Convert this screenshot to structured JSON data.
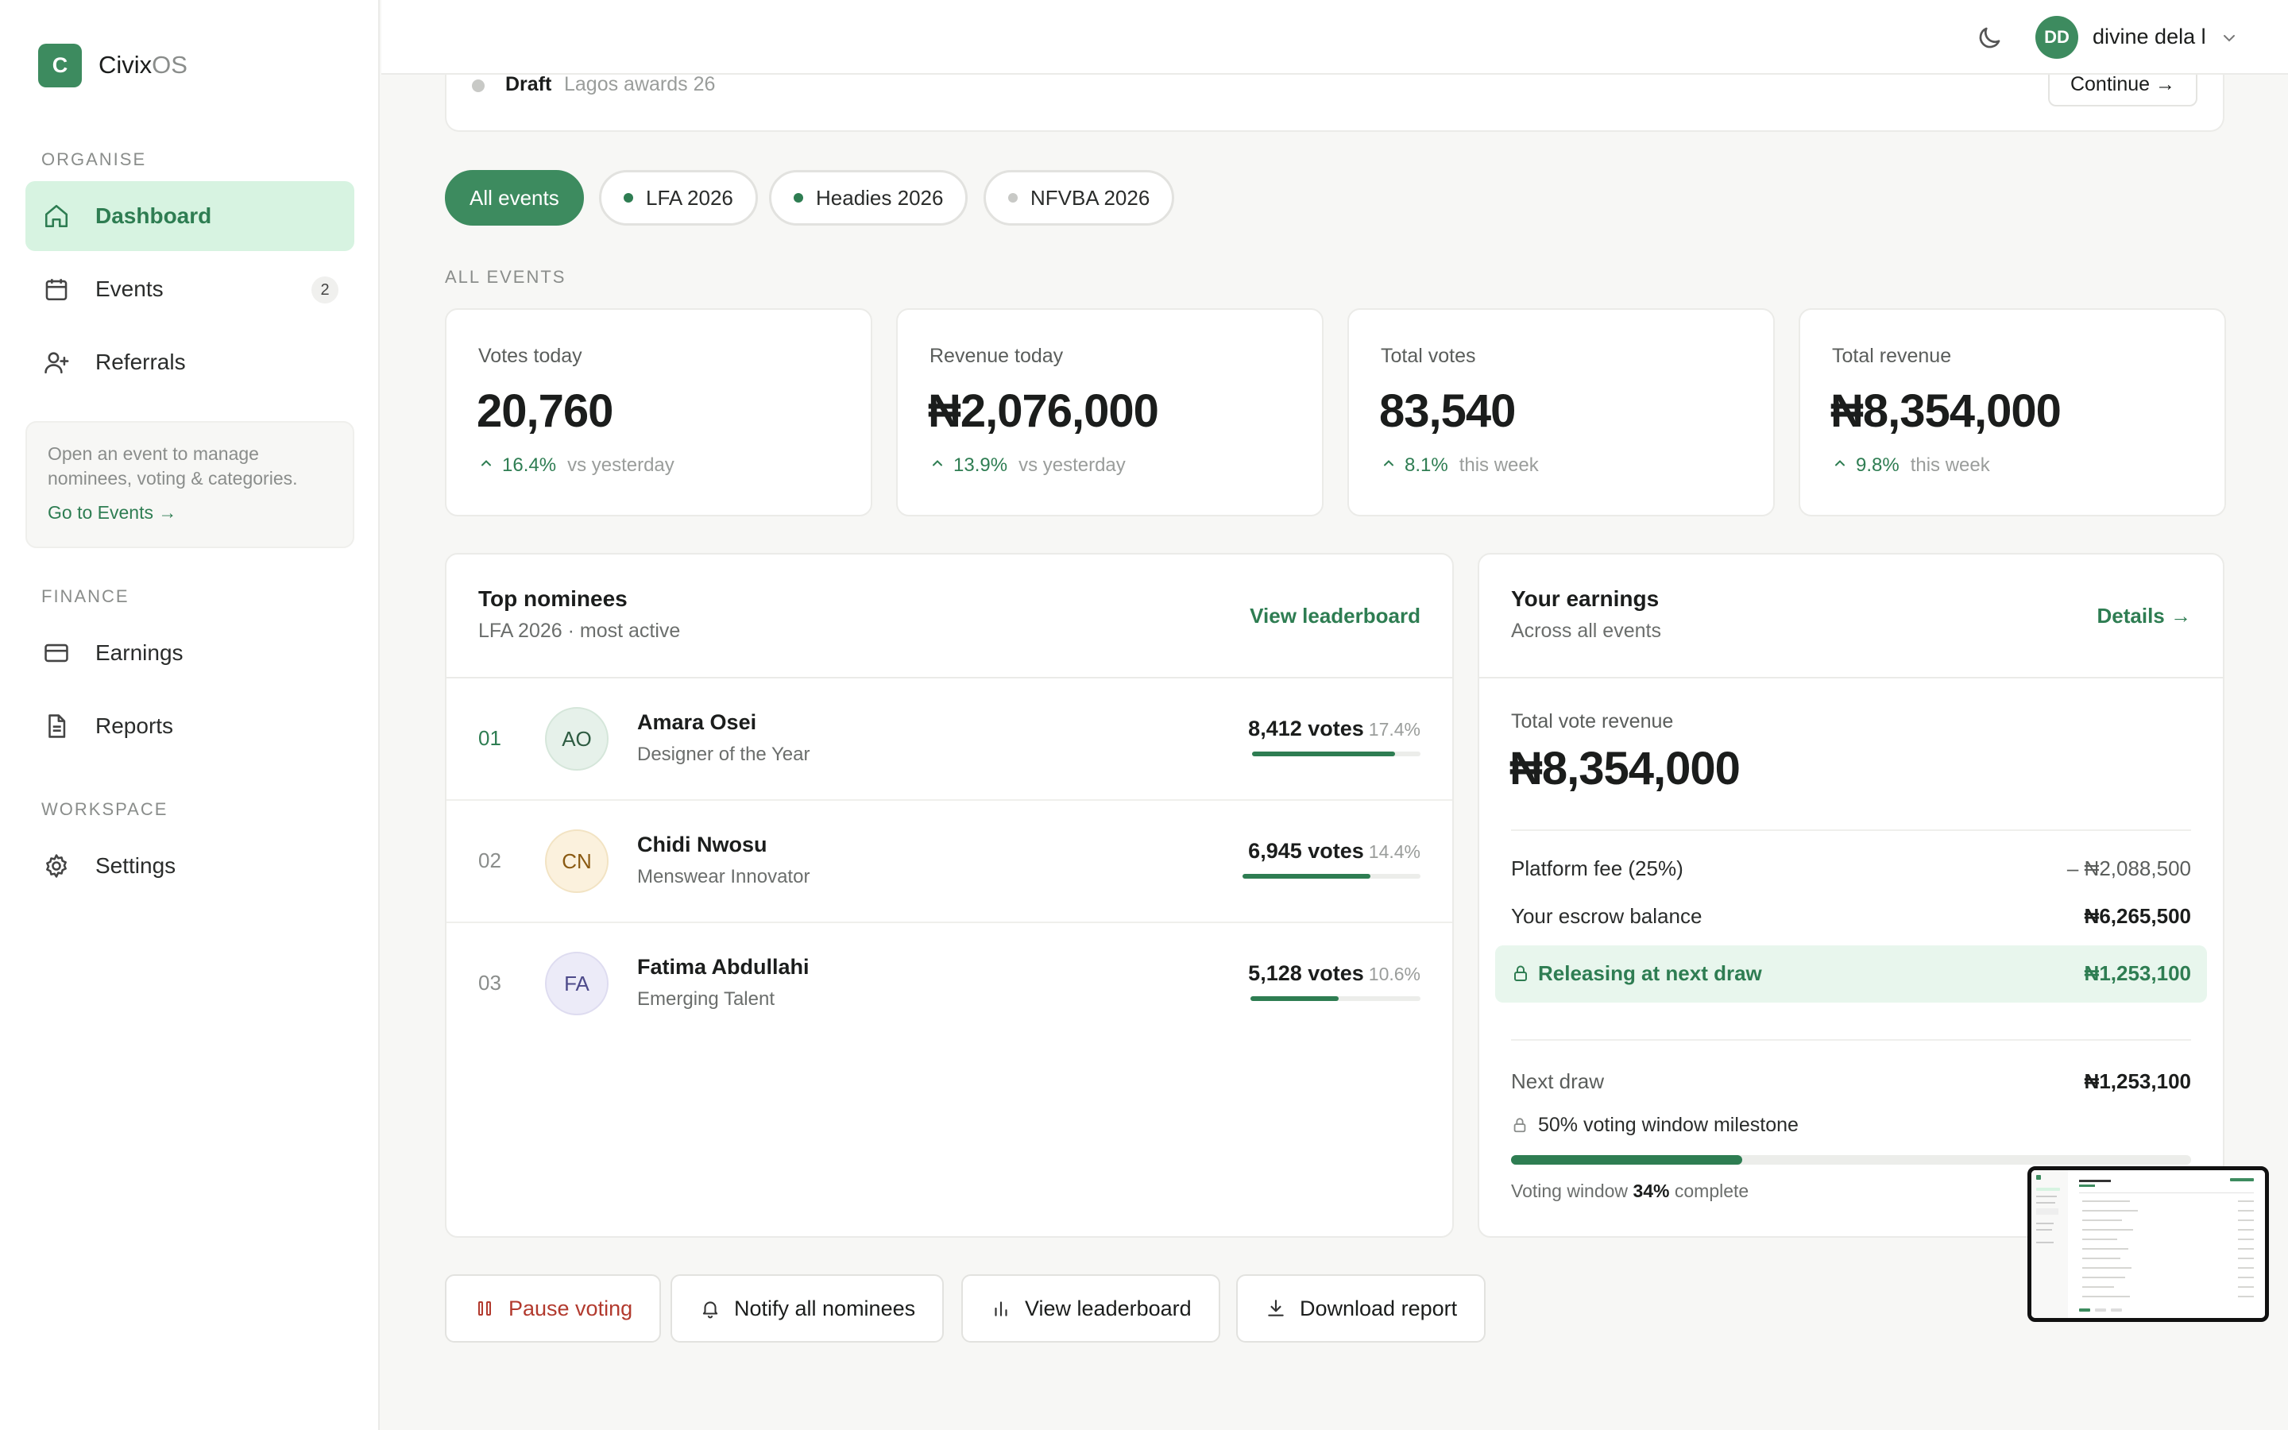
{
  "brand": {
    "badge": "C",
    "name": "Civix",
    "suffix": "OS"
  },
  "sidebar": {
    "sections": {
      "organise": "ORGANISE",
      "finance": "FINANCE",
      "workspace": "WORKSPACE"
    },
    "items": [
      {
        "label": "Dashboard",
        "icon": "home-icon"
      },
      {
        "label": "Events",
        "icon": "calendar-icon",
        "badge": "2"
      },
      {
        "label": "Referrals",
        "icon": "user-plus-icon"
      },
      {
        "label": "Earnings",
        "icon": "credit-card-icon"
      },
      {
        "label": "Reports",
        "icon": "document-icon"
      },
      {
        "label": "Settings",
        "icon": "gear-icon"
      }
    ],
    "hint": {
      "text": "Open an event to manage nominees, voting & categories.",
      "link": "Go to Events →"
    }
  },
  "header": {
    "avatar_initials": "DD",
    "user_name": "divine dela l"
  },
  "draft": {
    "status": "Draft",
    "name": "Lagos awards 26",
    "continue_label": "Continue →"
  },
  "filters": [
    {
      "label": "All events",
      "active": true
    },
    {
      "label": "LFA 2026",
      "dot_color": "#2e7d52"
    },
    {
      "label": "Headies 2026",
      "dot_color": "#2e7d52"
    },
    {
      "label": "NFVBA 2026",
      "dot_color": "#c8c9c6"
    }
  ],
  "all_events_label": "ALL EVENTS",
  "stats": [
    {
      "label": "Votes today",
      "value": "20,760",
      "delta": "16.4%",
      "note": "vs yesterday"
    },
    {
      "label": "Revenue today",
      "value": "₦2,076,000",
      "delta": "13.9%",
      "note": "vs yesterday"
    },
    {
      "label": "Total votes",
      "value": "83,540",
      "delta": "8.1%",
      "note": "this week"
    },
    {
      "label": "Total revenue",
      "value": "₦8,354,000",
      "delta": "9.8%",
      "note": "this week"
    }
  ],
  "nominees_panel": {
    "title": "Top nominees",
    "subtitle": "LFA 2026 · most active",
    "link": "View leaderboard",
    "rows": [
      {
        "rank": "01",
        "initials": "AO",
        "name": "Amara Osei",
        "category": "Designer of the Year",
        "votes": "8,412 votes",
        "pct": "17.4%",
        "bar_fraction": 0.85
      },
      {
        "rank": "02",
        "initials": "CN",
        "name": "Chidi Nwosu",
        "category": "Menswear Innovator",
        "votes": "6,945 votes",
        "pct": "14.4%",
        "bar_fraction": 0.72
      },
      {
        "rank": "03",
        "initials": "FA",
        "name": "Fatima Abdullahi",
        "category": "Emerging Talent",
        "votes": "5,128 votes",
        "pct": "10.6%",
        "bar_fraction": 0.52
      }
    ]
  },
  "earnings_panel": {
    "title": "Your earnings",
    "subtitle": "Across all events",
    "link": "Details →",
    "total_label": "Total vote revenue",
    "total_value": "₦8,354,000",
    "fee_label": "Platform fee (25%)",
    "fee_value": "– ₦2,088,500",
    "escrow_label": "Your escrow balance",
    "escrow_value": "₦6,265,500",
    "release_label": "Releasing at next draw",
    "release_value": "₦1,253,100",
    "next_draw_label": "Next draw",
    "next_draw_value": "₦1,253,100",
    "milestone": "50% voting window milestone",
    "window_prefix": "Voting window",
    "window_pct": "34%",
    "window_suffix": "complete",
    "window_fraction": 0.34
  },
  "actions": [
    {
      "label": "Pause voting",
      "icon": "pause-icon"
    },
    {
      "label": "Notify all nominees",
      "icon": "bell-icon"
    },
    {
      "label": "View leaderboard",
      "icon": "bar-chart-icon"
    },
    {
      "label": "Download report",
      "icon": "download-icon"
    }
  ],
  "colors": {
    "accent": "#2e7d52",
    "accent_bg": "#d7f3e1",
    "danger": "#b23a2e"
  }
}
